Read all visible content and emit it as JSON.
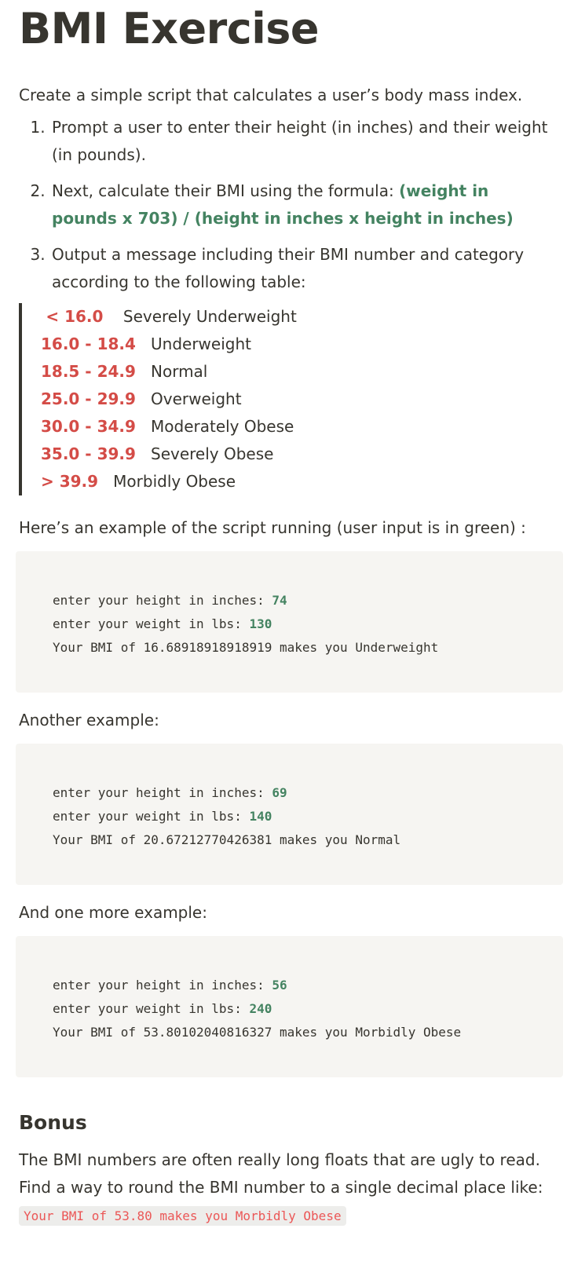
{
  "title": "BMI Exercise",
  "intro": "Create a simple script that calculates a user’s body mass index.",
  "steps": [
    {
      "text": "Prompt a user to enter their height (in inches) and their weight (in pounds)."
    },
    {
      "text": "Next, calculate their BMI using the formula: ",
      "formula": "(weight in pounds x 703) / (height in inches x height in inches)"
    },
    {
      "text": "Output a message including their BMI number and category according to the following table:"
    }
  ],
  "table": [
    {
      "range": "< 16.0",
      "category": "Severely Underweight"
    },
    {
      "range": "16.0 - 18.4",
      "category": "Underweight"
    },
    {
      "range": "18.5 - 24.9",
      "category": "Normal"
    },
    {
      "range": "25.0 - 29.9",
      "category": "Overweight"
    },
    {
      "range": "30.0 - 34.9",
      "category": "Moderately Obese"
    },
    {
      "range": "35.0 - 39.9",
      "category": "Severely Obese"
    },
    {
      "range": "> 39.9",
      "category": "Morbidly Obese"
    }
  ],
  "example_intro": "Here’s an example of the script running (user input is in green) :",
  "examples": [
    {
      "height_prompt": "enter your height in inches: ",
      "height": "74",
      "weight_prompt": "enter your weight in lbs: ",
      "weight": "130",
      "result": "Your BMI of 16.68918918918919 makes you Underweight"
    },
    {
      "height_prompt": "enter your height in inches: ",
      "height": "69",
      "weight_prompt": "enter your weight in lbs: ",
      "weight": "140",
      "result": "Your BMI of 20.67212770426381 makes you Normal"
    },
    {
      "height_prompt": "enter your height in inches: ",
      "height": "56",
      "weight_prompt": "enter your weight in lbs: ",
      "weight": "240",
      "result": "Your BMI of 53.80102040816327 makes you Morbidly Obese"
    }
  ],
  "another_label": "Another example:",
  "one_more_label": "And one more example:",
  "bonus": {
    "heading": "Bonus",
    "text": "The BMI numbers are often really long floats that are ugly to read. Find a way to round the BMI number to a single decimal place like: ",
    "code": "Your BMI of 53.80 makes you Morbidly Obese"
  },
  "colors": {
    "accent_green": "#448361",
    "range_red": "#d44c47",
    "code_bg": "#f6f5f2",
    "inline_code_red": "#eb5757"
  }
}
